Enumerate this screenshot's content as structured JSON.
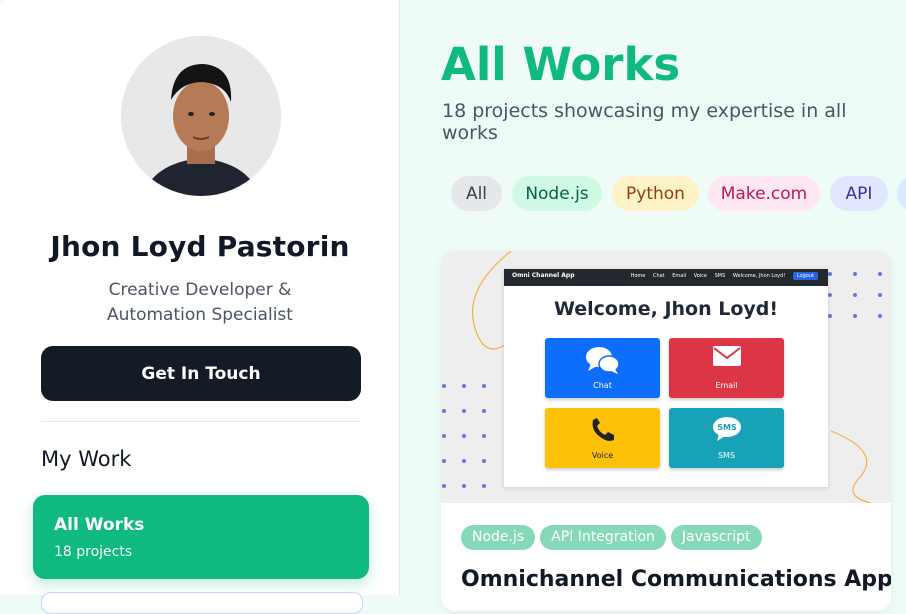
{
  "sidebar": {
    "name": "Jhon Loyd Pastorin",
    "title": "Creative Developer & Automation Specialist",
    "cta_label": "Get In Touch",
    "section_title": "My Work",
    "nav_active": {
      "label": "All Works",
      "count": "18 projects"
    }
  },
  "main": {
    "title": "All Works",
    "subtitle": "18 projects showcasing my expertise in all works",
    "filters": [
      {
        "label": "All",
        "bg": "#e5e7eb",
        "fg": "#374151"
      },
      {
        "label": "Node.js",
        "bg": "#d1fae5",
        "fg": "#065f46"
      },
      {
        "label": "Python",
        "bg": "#fef3c7",
        "fg": "#92400e"
      },
      {
        "label": "Make.com",
        "bg": "#fce7f3",
        "fg": "#be185d"
      },
      {
        "label": "API",
        "bg": "#e0e7ff",
        "fg": "#3730a3"
      }
    ]
  },
  "card": {
    "mock": {
      "brand": "Omni Channel App",
      "links": [
        "Home",
        "Chat",
        "Email",
        "Voice",
        "SMS",
        "Welcome, Jhon Loyd!"
      ],
      "logout": "Logout",
      "welcome": "Welcome, Jhon Loyd!",
      "tiles": [
        {
          "label": "Chat",
          "icon": "chat-icon",
          "color": "#0d6efd"
        },
        {
          "label": "Email",
          "icon": "envelope-icon",
          "color": "#dc3545"
        },
        {
          "label": "Voice",
          "icon": "phone-icon",
          "color": "#ffc107"
        },
        {
          "label": "SMS",
          "icon": "sms-icon",
          "color": "#17a2b8"
        }
      ]
    },
    "tags": [
      "Node.js",
      "API Integration",
      "Javascript"
    ],
    "title": "Omnichannel Communications App"
  },
  "colors": {
    "accent": "#10b981",
    "dark_button": "#141a26"
  }
}
